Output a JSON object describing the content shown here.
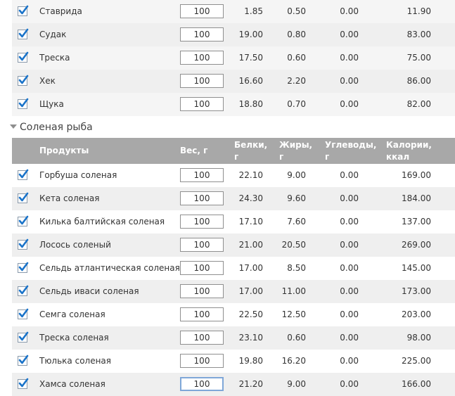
{
  "section_title": "Соленая рыба",
  "columns": {
    "product": "Продукты",
    "weight": "Вес, г",
    "protein_line1": "Белки,",
    "protein_line2": "г",
    "fat_line1": "Жиры,",
    "fat_line2": "г",
    "carbs_line1": "Углеводы,",
    "carbs_line2": "г",
    "calories_line1": "Калории,",
    "calories_line2": "ккал"
  },
  "top_rows": [
    {
      "name": "Ставрида",
      "weight": "100",
      "protein": "1.85",
      "fat": "0.50",
      "carbs": "0.00",
      "kcal": "11.90",
      "checked": true
    },
    {
      "name": "Судак",
      "weight": "100",
      "protein": "19.00",
      "fat": "0.80",
      "carbs": "0.00",
      "kcal": "83.00",
      "checked": true
    },
    {
      "name": "Треска",
      "weight": "100",
      "protein": "17.50",
      "fat": "0.60",
      "carbs": "0.00",
      "kcal": "75.00",
      "checked": true
    },
    {
      "name": "Хек",
      "weight": "100",
      "protein": "16.60",
      "fat": "2.20",
      "carbs": "0.00",
      "kcal": "86.00",
      "checked": true
    },
    {
      "name": "Щука",
      "weight": "100",
      "protein": "18.80",
      "fat": "0.70",
      "carbs": "0.00",
      "kcal": "82.00",
      "checked": true
    }
  ],
  "salted_rows": [
    {
      "name": "Горбуша соленая",
      "weight": "100",
      "protein": "22.10",
      "fat": "9.00",
      "carbs": "0.00",
      "kcal": "169.00",
      "checked": true
    },
    {
      "name": "Кета соленая",
      "weight": "100",
      "protein": "24.30",
      "fat": "9.60",
      "carbs": "0.00",
      "kcal": "184.00",
      "checked": true
    },
    {
      "name": "Килька балтийская соленая",
      "weight": "100",
      "protein": "17.10",
      "fat": "7.60",
      "carbs": "0.00",
      "kcal": "137.00",
      "checked": true
    },
    {
      "name": "Лосось соленый",
      "weight": "100",
      "protein": "21.00",
      "fat": "20.50",
      "carbs": "0.00",
      "kcal": "269.00",
      "checked": true
    },
    {
      "name": "Сельдь атлантическая соленая",
      "weight": "100",
      "protein": "17.00",
      "fat": "8.50",
      "carbs": "0.00",
      "kcal": "145.00",
      "checked": true
    },
    {
      "name": "Сельдь иваси соленая",
      "weight": "100",
      "protein": "17.00",
      "fat": "11.00",
      "carbs": "0.00",
      "kcal": "173.00",
      "checked": true
    },
    {
      "name": "Семга соленая",
      "weight": "100",
      "protein": "22.50",
      "fat": "12.50",
      "carbs": "0.00",
      "kcal": "203.00",
      "checked": true
    },
    {
      "name": "Треска соленая",
      "weight": "100",
      "protein": "23.10",
      "fat": "0.60",
      "carbs": "0.00",
      "kcal": "98.00",
      "checked": true
    },
    {
      "name": "Тюлька соленая",
      "weight": "100",
      "protein": "19.80",
      "fat": "16.20",
      "carbs": "0.00",
      "kcal": "225.00",
      "checked": true
    },
    {
      "name": "Хамса соленая",
      "weight": "100",
      "protein": "21.20",
      "fat": "9.00",
      "carbs": "0.00",
      "kcal": "166.00",
      "checked": true
    }
  ],
  "icons": {
    "checkbox": "checkmark-icon",
    "collapse": "triangle-down-icon"
  },
  "colors": {
    "check": "#1a73c9",
    "header_bg": "#a8a8a8",
    "row_alt": "#efefef",
    "focus_border": "#7fa7d8"
  }
}
